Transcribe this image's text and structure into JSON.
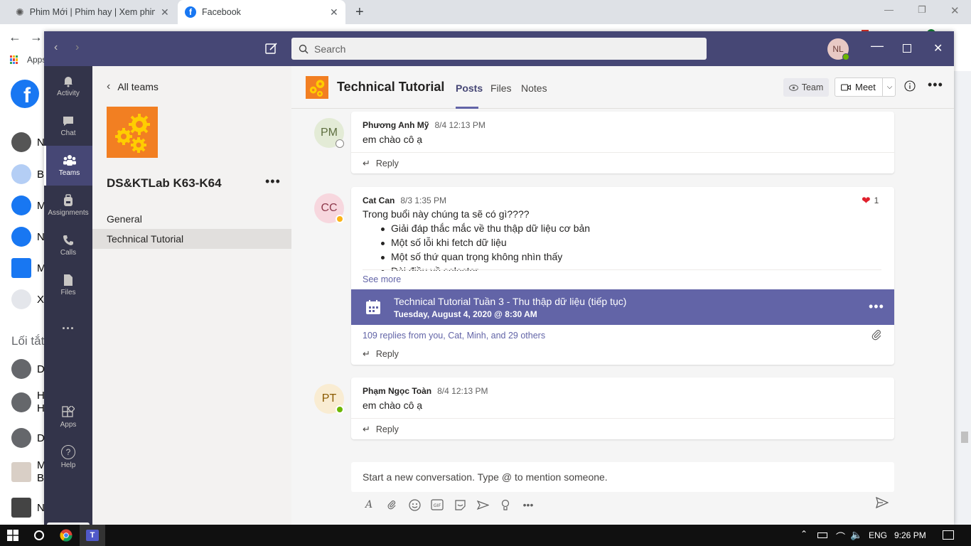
{
  "browser": {
    "tabs": [
      {
        "title": "Phim Mới | Phim hay | Xem phim"
      },
      {
        "title": "Facebook"
      }
    ],
    "bookmarks_apps": "Apps"
  },
  "facebook": {
    "sidebar_rows": [
      "N",
      "B",
      "M",
      "N",
      "M",
      "X"
    ],
    "shortcuts_heading": "Lối tắt",
    "shortcut_rows": [
      "D",
      "H",
      "H",
      "D",
      "M",
      "B",
      "N"
    ]
  },
  "teams": {
    "search_placeholder": "Search",
    "user_initials": "NL",
    "rail": [
      {
        "label": "Activity"
      },
      {
        "label": "Chat"
      },
      {
        "label": "Teams"
      },
      {
        "label": "Assignments"
      },
      {
        "label": "Calls"
      },
      {
        "label": "Files"
      },
      {
        "label": "..."
      },
      {
        "label": "Apps"
      },
      {
        "label": "Help"
      }
    ],
    "left_panel": {
      "back_label": "All teams",
      "team_name": "DS&KTLab K63-K64",
      "channels": [
        "General",
        "Technical Tutorial"
      ]
    },
    "channel": {
      "title": "Technical Tutorial",
      "tabs": [
        "Posts",
        "Files",
        "Notes"
      ],
      "team_button": "Team",
      "meet_button": "Meet"
    },
    "posts": [
      {
        "initials": "PM",
        "author": "Phương Anh Mỹ",
        "time": "8/4 12:13 PM",
        "body": "em chào cô ạ",
        "reply": "Reply"
      },
      {
        "initials": "CC",
        "author": "Cat Can",
        "time": "8/3 1:35 PM",
        "reaction_count": "1",
        "body": "Trong buổi này chúng ta sẽ có gì????",
        "bullets": [
          "Giải đáp thắc mắc về thu thập dữ liệu cơ bản",
          "Một số lỗi khi fetch dữ liệu",
          "Một số thứ quan trọng không nhìn thấy",
          "Dài điều về selector"
        ],
        "see_more": "See more",
        "meeting_title": "Technical Tutorial Tuần 3 - Thu thập dữ liệu (tiếp tục)",
        "meeting_date": "Tuesday, August 4, 2020 @ 8:30 AM",
        "replies_summary": "109 replies from you, Cat, Minh, and 29 others",
        "reply": "Reply"
      },
      {
        "initials": "PT",
        "author": "Phạm Ngọc Toàn",
        "time": "8/4 12:13 PM",
        "body": "em chào cô ạ",
        "reply": "Reply"
      }
    ],
    "compose_placeholder": "Start a new conversation. Type @ to mention someone."
  },
  "taskbar": {
    "language": "ENG",
    "time": "9:26 PM"
  },
  "colors": {
    "teams_purple": "#464775",
    "teams_accent": "#6264a7",
    "rail_bg": "#33344a",
    "team_logo_orange": "#f27f22",
    "facebook_blue": "#1877f2"
  }
}
